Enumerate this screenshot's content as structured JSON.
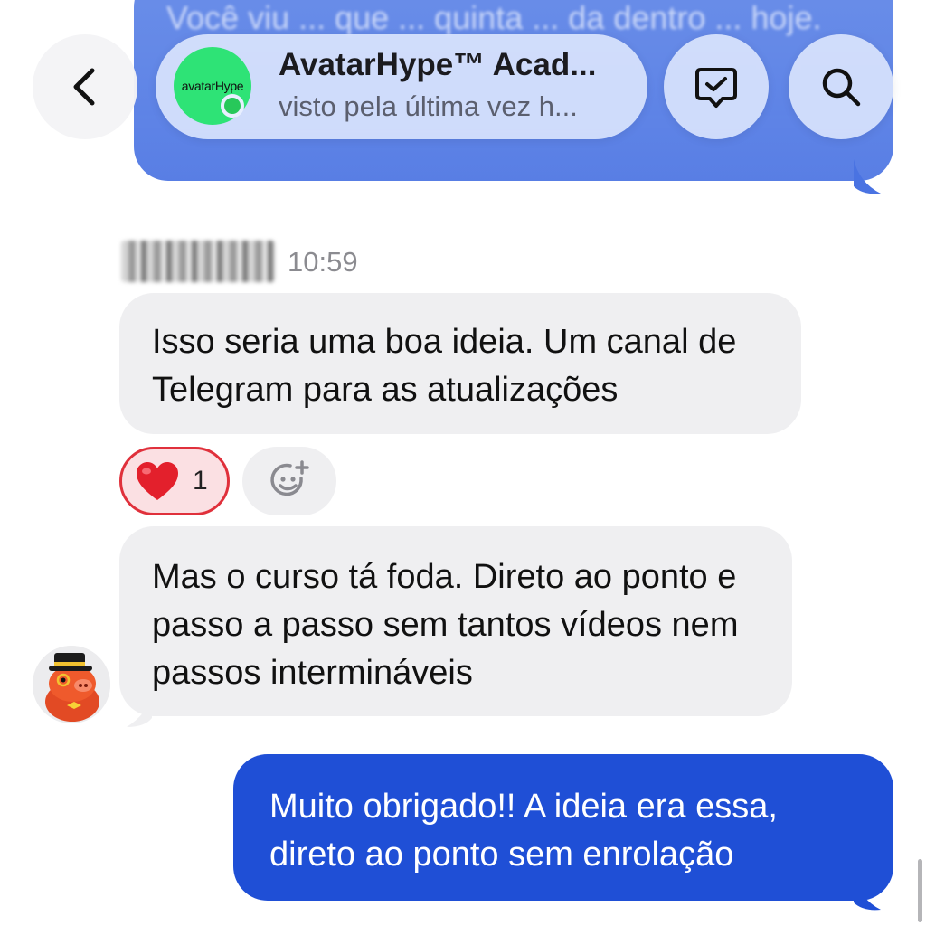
{
  "header": {
    "back_icon": "chevron-left-icon",
    "chat_name": "AvatarHype™ Acad...",
    "status": "visto pela última vez h...",
    "logo_text": "avatarHype",
    "todo_icon": "chat-check-icon",
    "search_icon": "search-icon",
    "colors": {
      "logo_bg": "#2ee376",
      "online": "#27c85a"
    }
  },
  "messages": {
    "top_outgoing_text": "Você viu ... que ... quinta ... da dentro ... hoje.",
    "sender": {
      "time": "10:59"
    },
    "incoming_1": "Isso seria uma boa ideia. Um canal de Telegram para as atualizações",
    "reaction": {
      "emoji": "❤️",
      "count": "1"
    },
    "add_reaction_icon": "add-emoji-icon",
    "incoming_2": "Mas o curso tá foda. Direto ao ponto e passo a passo sem tantos vídeos nem passos intermináveis",
    "outgoing_1": "Muito obrigado!! A ideia era essa, direto ao ponto sem enrolação"
  },
  "colors": {
    "outgoing_bubble": "#1f4fd6",
    "incoming_bubble": "#efeff1",
    "reaction_border": "#e0303b"
  }
}
